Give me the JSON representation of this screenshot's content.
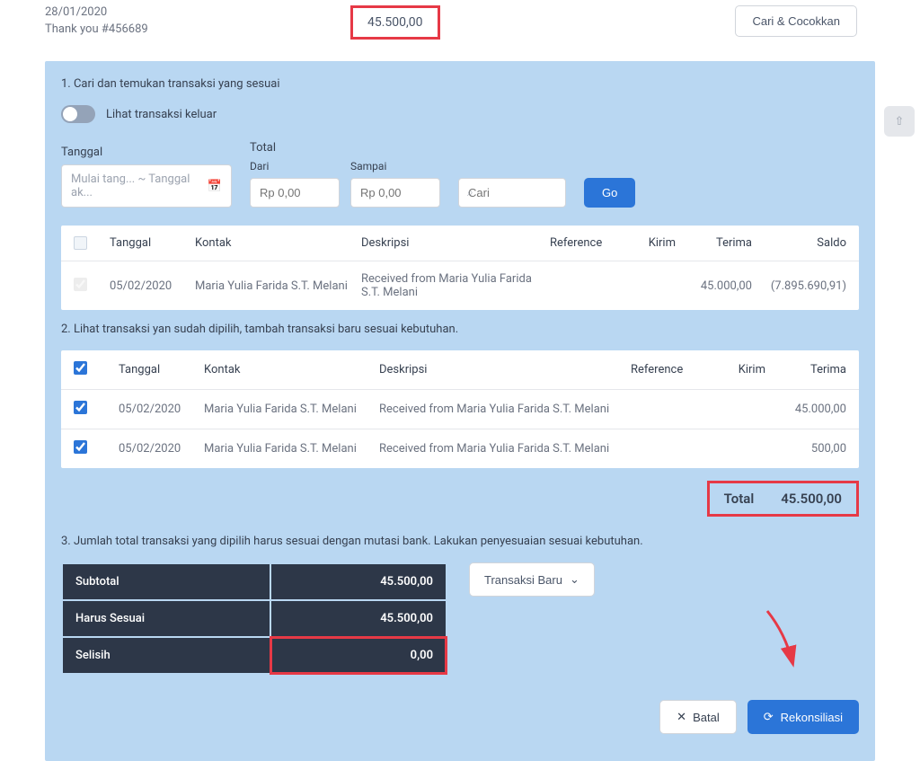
{
  "header": {
    "date": "28/01/2020",
    "reference": "Thank you #456689",
    "amount": "45.500,00",
    "match_button": "Cari & Cocokkan"
  },
  "step1": {
    "title": "1. Cari dan temukan transaksi yang sesuai",
    "toggle_label": "Lihat transaksi keluar",
    "labels": {
      "tanggal": "Tanggal",
      "total": "Total",
      "dari": "Dari",
      "sampai": "Sampai"
    },
    "placeholders": {
      "date_range": "Mulai tang... ~ Tanggal ak...",
      "amount_from": "Rp 0,00",
      "amount_to": "Rp 0,00",
      "search": "Cari"
    },
    "go_button": "Go",
    "columns": {
      "tanggal": "Tanggal",
      "kontak": "Kontak",
      "deskripsi": "Deskripsi",
      "reference": "Reference",
      "kirim": "Kirim",
      "terima": "Terima",
      "saldo": "Saldo"
    },
    "rows": [
      {
        "checked": false,
        "tanggal": "05/02/2020",
        "kontak": "Maria Yulia Farida S.T. Melani",
        "deskripsi": "Received from Maria Yulia Farida S.T. Melani",
        "reference": "",
        "kirim": "",
        "terima": "45.000,00",
        "saldo": "(7.895.690,91)"
      }
    ]
  },
  "step2": {
    "title": "2. Lihat transaksi yan sudah dipilih, tambah transaksi baru sesuai kebutuhan.",
    "columns": {
      "tanggal": "Tanggal",
      "kontak": "Kontak",
      "deskripsi": "Deskripsi",
      "reference": "Reference",
      "kirim": "Kirim",
      "terima": "Terima"
    },
    "rows": [
      {
        "checked": true,
        "tanggal": "05/02/2020",
        "kontak": "Maria Yulia Farida S.T. Melani",
        "deskripsi": "Received from Maria Yulia Farida S.T. Melani",
        "reference": "",
        "kirim": "",
        "terima": "45.000,00"
      },
      {
        "checked": true,
        "tanggal": "05/02/2020",
        "kontak": "Maria Yulia Farida S.T. Melani",
        "deskripsi": "Received from Maria Yulia Farida S.T. Melani",
        "reference": "",
        "kirim": "",
        "terima": "500,00"
      }
    ],
    "total_label": "Total",
    "total_value": "45.500,00"
  },
  "step3": {
    "title": "3. Jumlah total transaksi yang dipilih harus sesuai dengan mutasi bank. Lakukan penyesuaian sesuai kebutuhan.",
    "summary": {
      "subtotal_label": "Subtotal",
      "subtotal_value": "45.500,00",
      "must_match_label": "Harus Sesuai",
      "must_match_value": "45.500,00",
      "difference_label": "Selisih",
      "difference_value": "0,00"
    },
    "new_transaction_button": "Transaksi Baru"
  },
  "actions": {
    "cancel": "Batal",
    "reconcile": "Rekonsiliasi"
  }
}
